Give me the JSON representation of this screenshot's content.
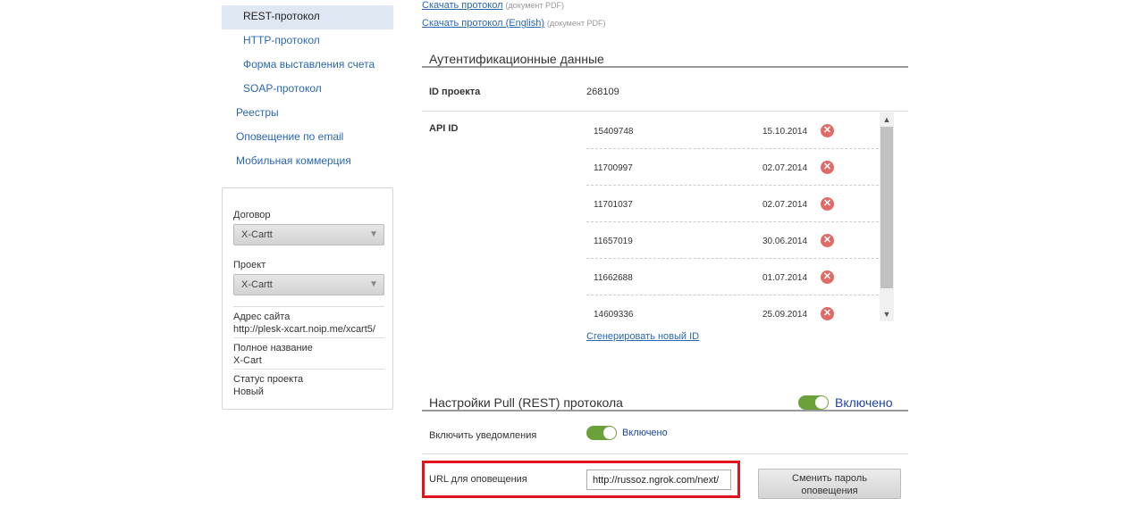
{
  "sidebar": {
    "nav": [
      {
        "label": "REST-протокол",
        "active": true
      },
      {
        "label": "HTTP-протокол"
      },
      {
        "label": "Форма выставления счета"
      },
      {
        "label": "SOAP-протокол"
      },
      {
        "label": "Реестры"
      },
      {
        "label": "Оповещение по email"
      },
      {
        "label": "Мобильная коммерция"
      }
    ],
    "contract": {
      "label": "Договор",
      "value": "X-Cartt"
    },
    "project": {
      "label": "Проект",
      "value": "X-Cartt"
    },
    "site": {
      "label": "Адрес сайта",
      "value": "http://plesk-xcart.noip.me/xcart5/"
    },
    "full_name": {
      "label": "Полное название",
      "value": "X-Cart"
    },
    "status": {
      "label": "Статус проекта",
      "value": "Новый"
    }
  },
  "docs": {
    "download_protocol": "Скачать протокол",
    "download_protocol_en": "Скачать протокол (English)",
    "pdf_hint": "(документ PDF)"
  },
  "auth": {
    "title": "Аутентификационные данные",
    "project_id_label": "ID проекта",
    "project_id": "268109",
    "api_id_label": "API ID",
    "api_ids": [
      {
        "id": "15409748",
        "date": "15.10.2014"
      },
      {
        "id": "11700997",
        "date": "02.07.2014"
      },
      {
        "id": "11701037",
        "date": "02.07.2014"
      },
      {
        "id": "11657019",
        "date": "30.06.2014"
      },
      {
        "id": "11662688",
        "date": "01.07.2014"
      },
      {
        "id": "14609336",
        "date": "25.09.2014"
      }
    ],
    "delete_glyph": "✕",
    "generate_link": "Сгенерировать новый ID"
  },
  "pull": {
    "title": "Настройки Pull (REST) протокола",
    "toggle_label": "Включено",
    "notifications_label": "Включить уведомления",
    "notifications_toggle_label": "Включено",
    "url_label": "URL для оповещения",
    "url_value": "http://russoz.ngrok.com/next/",
    "change_password_line1": "Сменить пароль",
    "change_password_line2": "оповещения"
  },
  "colors": {
    "link": "#2a67b3",
    "toggle_on": "#6ba13a",
    "highlight_border": "#e0141c",
    "delete_icon": "#e06b66"
  }
}
